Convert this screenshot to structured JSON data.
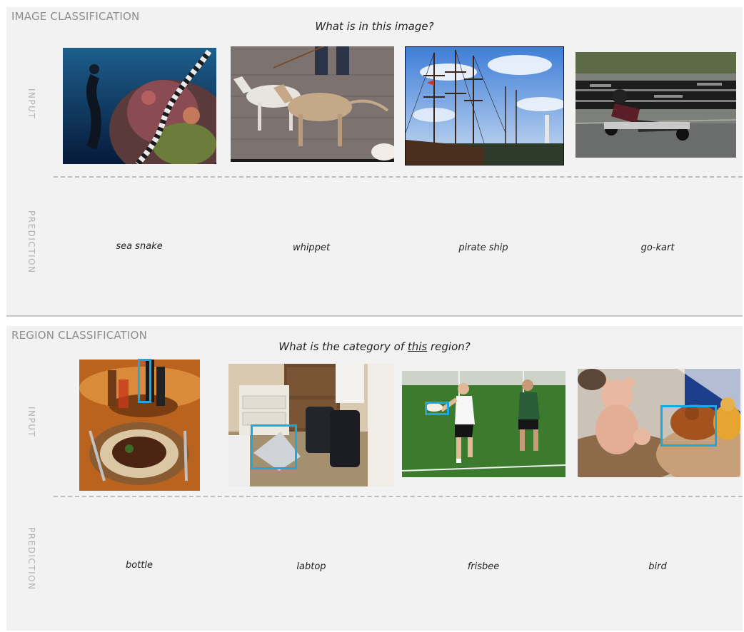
{
  "image_classification": {
    "title": "IMAGE CLASSIFICATION",
    "question": "What is in this image?",
    "input_label": "INPUT",
    "prediction_label": "PREDICTION",
    "items": [
      {
        "image": "underwater diver with sea snake photo",
        "prediction": "sea snake"
      },
      {
        "image": "two whippet dogs on leash photo",
        "prediction": "whippet"
      },
      {
        "image": "tall sailing ship in harbor photo",
        "prediction": "pirate ship"
      },
      {
        "image": "go-kart racer on track photo",
        "prediction": "go-kart"
      }
    ]
  },
  "region_classification": {
    "title": "REGION CLASSIFICATION",
    "question_before": "What is the category of ",
    "question_underlined": "this",
    "question_after": " region?",
    "input_label": "INPUT",
    "prediction_label": "PREDICTION",
    "items": [
      {
        "image": "dinner table with bottles and plate photo",
        "prediction": "bottle"
      },
      {
        "image": "dorm room with laptop and bags photo",
        "prediction": "labtop"
      },
      {
        "image": "two men playing frisbee on grass photo",
        "prediction": "frisbee"
      },
      {
        "image": "stuffed teddy bear and toy bird photo",
        "prediction": "bird"
      }
    ]
  },
  "colors": {
    "panel": "#f2f2f2",
    "highlight_box": "#19a9e2",
    "dashed_line": "#bdbdbd"
  }
}
